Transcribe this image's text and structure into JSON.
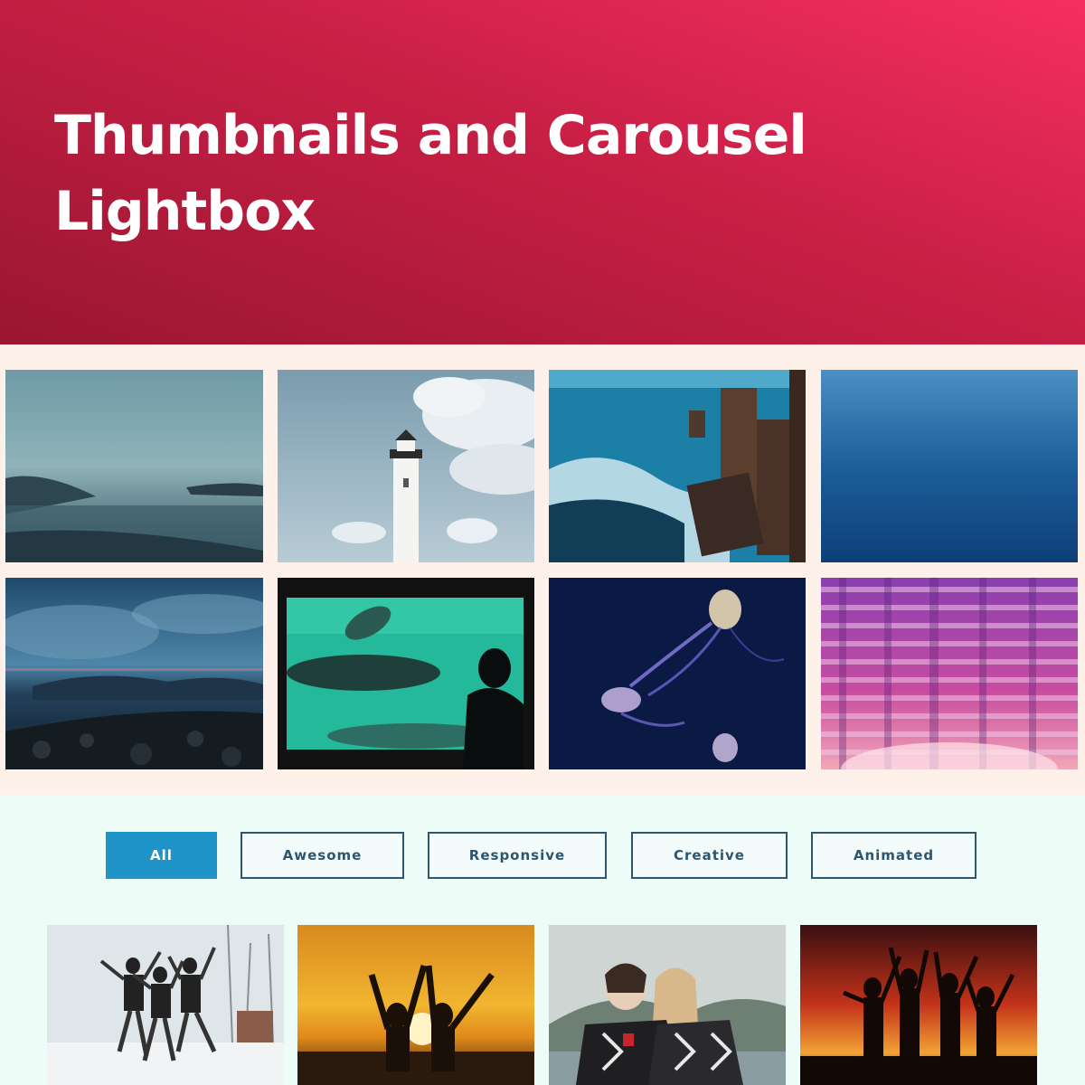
{
  "hero": {
    "title_line1": "Thumbnails and Carousel",
    "title_line2": "Lightbox"
  },
  "carousel_gallery": {
    "images": [
      {
        "subject": "misty lake with hills"
      },
      {
        "subject": "white lighthouse under clouds"
      },
      {
        "subject": "waves crashing on wooden pier"
      },
      {
        "subject": "calm deep blue water"
      },
      {
        "subject": "rocky shore at dusk"
      },
      {
        "subject": "person watching sea lions in aquarium"
      },
      {
        "subject": "jellyfish in dark water"
      },
      {
        "subject": "pink window blinds with light"
      }
    ]
  },
  "filters": {
    "all": "All",
    "awesome": "Awesome",
    "responsive": "Responsive",
    "creative": "Creative",
    "animated": "Animated",
    "active": "All"
  },
  "thumbnail_gallery": {
    "images": [
      {
        "subject": "four friends jumping in snow"
      },
      {
        "subject": "two people raising arms at sunset"
      },
      {
        "subject": "two women laughing near cliffs"
      },
      {
        "subject": "silhouettes of group dancing at sunset"
      }
    ]
  },
  "colors": {
    "hero_gradient_start": "#f52f61",
    "hero_gradient_end": "#9a1631",
    "accent_blue": "#1e94c8",
    "button_border": "#2c5670",
    "gallery_bg": "#fdf1ea",
    "section_bg": "#eefcf8"
  }
}
